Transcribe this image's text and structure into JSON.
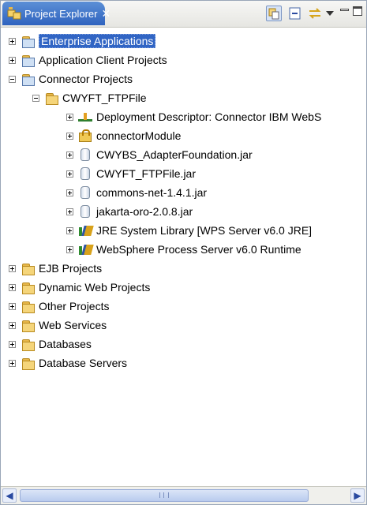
{
  "view": {
    "tab_title": "Project Explorer",
    "close_glyph": "✕"
  },
  "tree": {
    "items": [
      {
        "label": "Enterprise Applications",
        "expanded": false,
        "selected": true,
        "icon": "enterprise-project-icon"
      },
      {
        "label": "Application Client Projects",
        "expanded": false,
        "icon": "app-client-project-icon"
      },
      {
        "label": "Connector Projects",
        "expanded": true,
        "icon": "connector-projects-icon"
      },
      {
        "label": "CWYFT_FTPFile",
        "expanded": true,
        "icon": "connector-project-folder-icon"
      },
      {
        "label": "Deployment Descriptor: Connector IBM WebS",
        "expanded": false,
        "icon": "deployment-descriptor-icon"
      },
      {
        "label": "connectorModule",
        "expanded": false,
        "icon": "connector-module-icon"
      },
      {
        "label": "CWYBS_AdapterFoundation.jar",
        "expanded": false,
        "icon": "jar-icon"
      },
      {
        "label": "CWYFT_FTPFile.jar",
        "expanded": false,
        "icon": "jar-icon"
      },
      {
        "label": "commons-net-1.4.1.jar",
        "expanded": false,
        "icon": "jar-icon"
      },
      {
        "label": "jakarta-oro-2.0.8.jar",
        "expanded": false,
        "icon": "jar-icon"
      },
      {
        "label": "JRE System Library [WPS Server v6.0 JRE]",
        "expanded": false,
        "icon": "library-icon"
      },
      {
        "label": "WebSphere Process Server v6.0 Runtime",
        "expanded": false,
        "icon": "library-icon"
      },
      {
        "label": "EJB Projects",
        "expanded": false,
        "icon": "ejb-projects-icon"
      },
      {
        "label": "Dynamic Web Projects",
        "expanded": false,
        "icon": "web-projects-icon"
      },
      {
        "label": "Other Projects",
        "expanded": false,
        "icon": "folder-icon"
      },
      {
        "label": "Web Services",
        "expanded": false,
        "icon": "web-services-icon"
      },
      {
        "label": "Databases",
        "expanded": false,
        "icon": "databases-icon"
      },
      {
        "label": "Database Servers",
        "expanded": false,
        "icon": "database-servers-icon"
      }
    ]
  },
  "colors": {
    "tab_active": "#3a6fc9",
    "selection": "#3165c4"
  }
}
